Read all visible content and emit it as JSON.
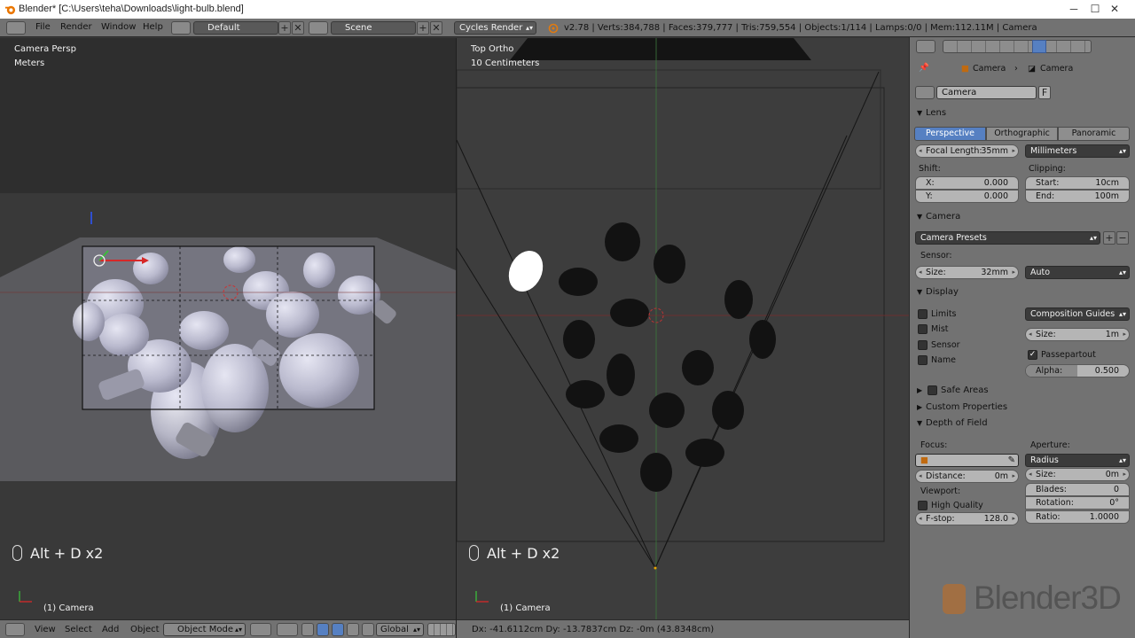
{
  "window": {
    "title": "Blender* [C:\\Users\\teha\\Downloads\\light-bulb.blend]",
    "minimize": "─",
    "maximize": "☐",
    "close": "✕"
  },
  "menu": {
    "file": "File",
    "render": "Render",
    "window": "Window",
    "help": "Help"
  },
  "layout": {
    "value": "Default",
    "add": "+",
    "remove": "✕"
  },
  "scene": {
    "value": "Scene",
    "add": "+",
    "remove": "✕"
  },
  "engine": {
    "value": "Cycles Render"
  },
  "stats": "v2.78 | Verts:384,788 | Faces:379,777 | Tris:759,554 | Objects:1/114 | Lamps:0/0 | Mem:112.11M | Camera",
  "left_viewport": {
    "view": "Camera Persp",
    "units": "Meters",
    "hint": "Alt + D x2",
    "object": "(1) Camera"
  },
  "right_viewport": {
    "view": "Top Ortho",
    "units": "10 Centimeters",
    "hint": "Alt + D x2",
    "object": "(1) Camera"
  },
  "bottom_left": {
    "view": "View",
    "select": "Select",
    "add": "Add",
    "object": "Object",
    "mode": "Object Mode",
    "orientation": "Global"
  },
  "bottom_right": {
    "status": "Dx: -41.6112cm   Dy: -13.7837cm   Dz: -0m (43.8348cm)"
  },
  "properties": {
    "breadcrumb": [
      "Camera",
      "Camera"
    ],
    "datablock": "Camera",
    "fake_user": "F",
    "lens": {
      "header": "Lens",
      "tabs": [
        "Perspective",
        "Orthographic",
        "Panoramic"
      ],
      "active_tab": "Perspective",
      "focal_label": "Focal Length:",
      "focal_value": "35mm",
      "unit": "Millimeters",
      "shift_label": "Shift:",
      "shift_x_label": "X:",
      "shift_x": "0.000",
      "shift_y_label": "Y:",
      "shift_y": "0.000",
      "clip_label": "Clipping:",
      "clip_start_label": "Start:",
      "clip_start": "10cm",
      "clip_end_label": "End:",
      "clip_end": "100m"
    },
    "camera": {
      "header": "Camera",
      "presets": "Camera Presets",
      "sensor_label": "Sensor:",
      "size_label": "Size:",
      "size_value": "32mm",
      "fit": "Auto"
    },
    "display": {
      "header": "Display",
      "limits": "Limits",
      "mist": "Mist",
      "sensor": "Sensor",
      "name": "Name",
      "guides": "Composition Guides",
      "size_label": "Size:",
      "size_value": "1m",
      "passepartout": "Passepartout",
      "alpha_label": "Alpha:",
      "alpha_value": "0.500",
      "alpha_fraction": 0.5
    },
    "safe_areas": "Safe Areas",
    "custom_properties": "Custom Properties",
    "dof": {
      "header": "Depth of Field",
      "focus_label": "Focus:",
      "distance_label": "Distance:",
      "distance_value": "0m",
      "viewport_label": "Viewport:",
      "high_quality": "High Quality",
      "fstop_label": "F-stop:",
      "fstop_value": "128.0",
      "aperture_label": "Aperture:",
      "aperture_type": "Radius",
      "size_label": "Size:",
      "size_value": "0m",
      "blades_label": "Blades:",
      "blades_value": "0",
      "rotation_label": "Rotation:",
      "rotation_value": "0°",
      "ratio_label": "Ratio:",
      "ratio_value": "1.0000"
    }
  },
  "watermark": "Blender3D",
  "colors": {
    "accent": "#5680c2",
    "header": "#727272",
    "viewport_left": "#393939",
    "viewport_right": "#3d3d3d",
    "grid_red": "#8a3030",
    "grid_green": "#3b7a3b"
  }
}
